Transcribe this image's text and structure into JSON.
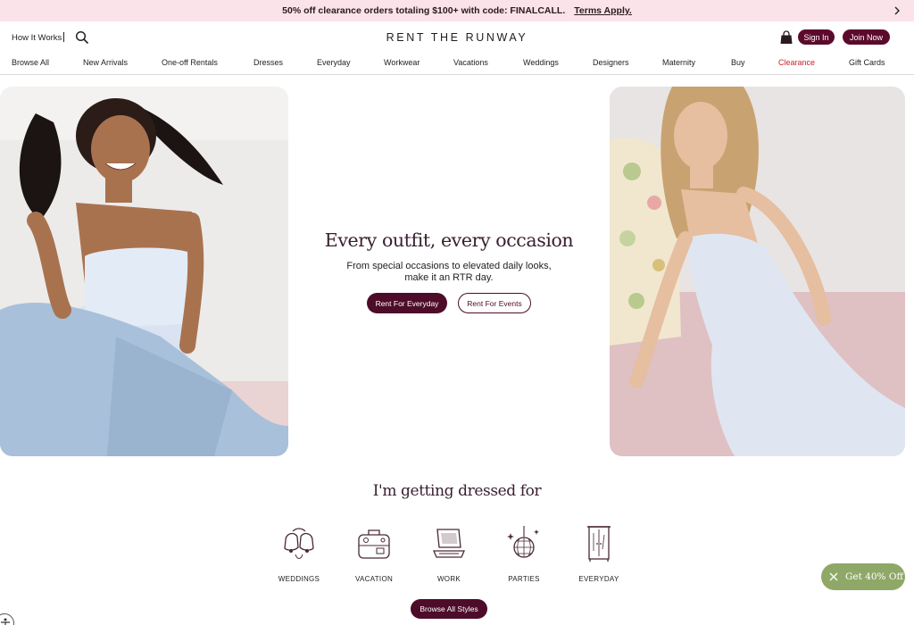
{
  "promo": {
    "message": "50% off clearance orders totaling $100+ with code: FINALCALL.",
    "terms_label": "Terms Apply."
  },
  "header": {
    "how_it_works": "How It Works",
    "logo": "RENT THE RUNWAY",
    "sign_in": "Sign In",
    "join_now": "Join Now"
  },
  "nav": {
    "items": [
      {
        "label": "Browse All"
      },
      {
        "label": "New Arrivals"
      },
      {
        "label": "One-off Rentals"
      },
      {
        "label": "Dresses"
      },
      {
        "label": "Everyday"
      },
      {
        "label": "Workwear"
      },
      {
        "label": "Vacations"
      },
      {
        "label": "Weddings"
      },
      {
        "label": "Designers"
      },
      {
        "label": "Maternity"
      },
      {
        "label": "Buy"
      },
      {
        "label": "Clearance"
      },
      {
        "label": "Gift Cards"
      }
    ]
  },
  "hero": {
    "title": "Every outfit, every occasion",
    "subtitle_line1": "From special occasions to elevated daily looks,",
    "subtitle_line2": "make it an RTR day.",
    "primary_cta": "Rent For Everyday",
    "secondary_cta": "Rent For Events"
  },
  "occasions": {
    "title": "I'm getting dressed for",
    "items": [
      {
        "label": "WEDDINGS",
        "icon": "wedding-bells-icon"
      },
      {
        "label": "VACATION",
        "icon": "suitcase-icon"
      },
      {
        "label": "WORK",
        "icon": "laptop-icon"
      },
      {
        "label": "PARTIES",
        "icon": "disco-ball-icon"
      },
      {
        "label": "EVERYDAY",
        "icon": "wardrobe-icon"
      }
    ],
    "browse_all": "Browse All Styles"
  },
  "offer": {
    "label": "Get 40% Off"
  },
  "colors": {
    "brand": "#5c0a2c",
    "promo_bg": "#fbe3ea",
    "sale": "#cc1f2a",
    "offer_bg": "#8fa868"
  }
}
